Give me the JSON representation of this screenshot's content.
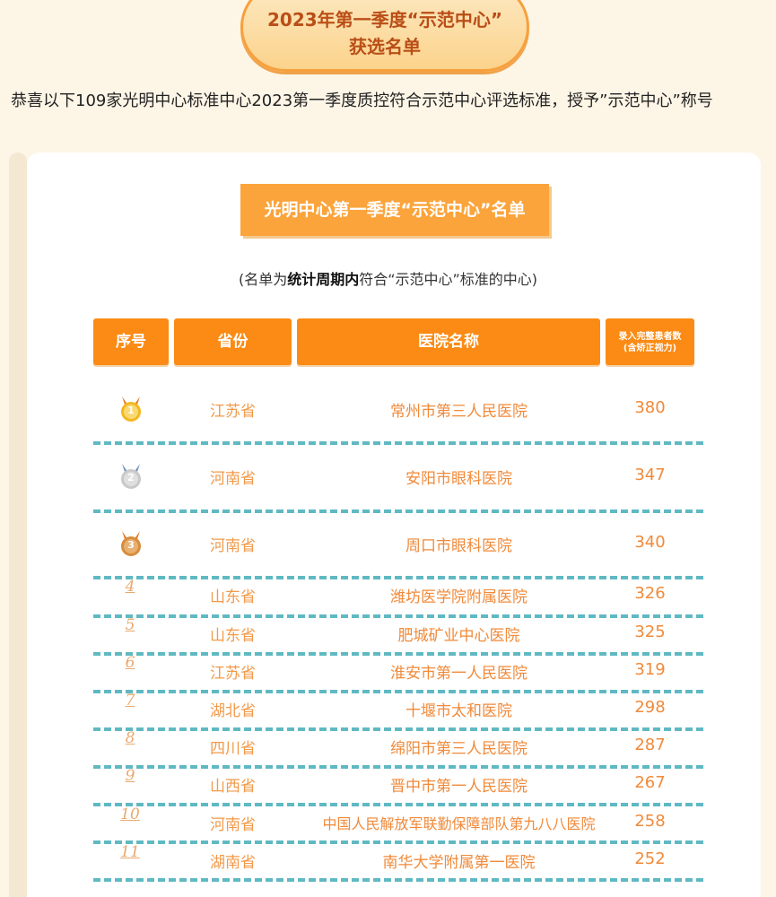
{
  "banner": {
    "line1": "2023年第一季度“示范中心”",
    "line2": "获选名单"
  },
  "intro": "恭喜以下109家光明中心标准中心2023第一季度质控符合示范中心评选标准，授予”示范中心”称号",
  "list_title": "光明中心第一季度“示范中心”名单",
  "note": {
    "prefix": "(名单为",
    "bold": "统计周期内",
    "suffix": "符合“示范中心”标准的中心)"
  },
  "headers": {
    "rank": "序号",
    "province": "省份",
    "hospital": "医院名称",
    "count_line1": "录入完整患者数",
    "count_line2": "(含矫正视力)"
  },
  "colors": {
    "accent": "#fb8b14",
    "gold": "#f3b81f",
    "silver": "#c9c9c9",
    "bronze": "#d78d3d",
    "dash": "#5fb9c3"
  },
  "rows": [
    {
      "rank": "1",
      "medal": "gold-medal-icon",
      "province": "江苏省",
      "hospital": "常州市第三人民医院",
      "count": "380"
    },
    {
      "rank": "2",
      "medal": "silver-medal-icon",
      "province": "河南省",
      "hospital": "安阳市眼科医院",
      "count": "347"
    },
    {
      "rank": "3",
      "medal": "bronze-medal-icon",
      "province": "河南省",
      "hospital": "周口市眼科医院",
      "count": "340"
    },
    {
      "rank": "4",
      "province": "山东省",
      "hospital": "潍坊医学院附属医院",
      "count": "326"
    },
    {
      "rank": "5",
      "province": "山东省",
      "hospital": "肥城矿业中心医院",
      "count": "325"
    },
    {
      "rank": "6",
      "province": "江苏省",
      "hospital": "淮安市第一人民医院",
      "count": "319"
    },
    {
      "rank": "7",
      "province": "湖北省",
      "hospital": "十堰市太和医院",
      "count": "298"
    },
    {
      "rank": "8",
      "province": "四川省",
      "hospital": "绵阳市第三人民医院",
      "count": "287"
    },
    {
      "rank": "9",
      "province": "山西省",
      "hospital": "晋中市第一人民医院",
      "count": "267"
    },
    {
      "rank": "10",
      "province": "河南省",
      "hospital": "中国人民解放军联勤保障部队第九八八医院",
      "count": "258"
    },
    {
      "rank": "11",
      "province": "湖南省",
      "hospital": "南华大学附属第一医院",
      "count": "252"
    }
  ]
}
